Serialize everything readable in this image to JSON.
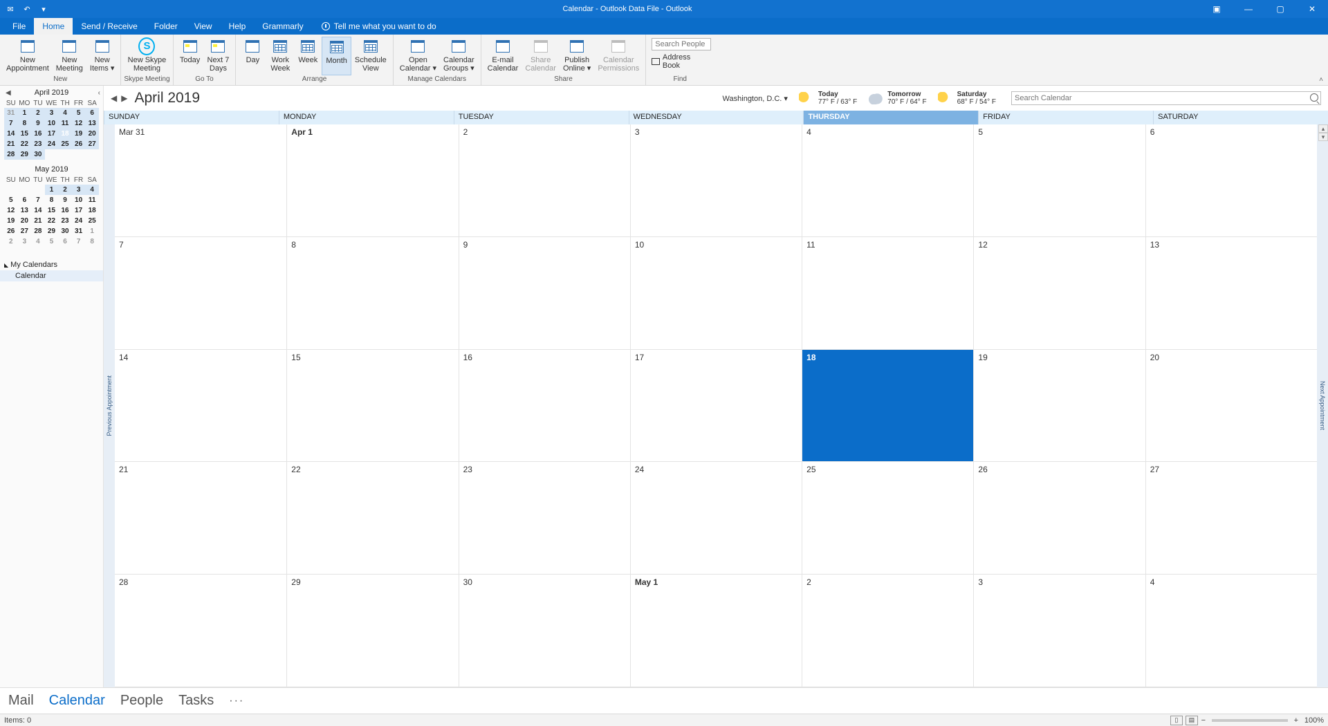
{
  "title": "Calendar - Outlook Data File  -  Outlook",
  "tabs": {
    "file": "File",
    "home": "Home",
    "sendrecv": "Send / Receive",
    "folder": "Folder",
    "view": "View",
    "help": "Help",
    "grammarly": "Grammarly",
    "tellme": "Tell me what you want to do"
  },
  "ribbon": {
    "new": {
      "label": "New",
      "appointment": "New\nAppointment",
      "meeting": "New\nMeeting",
      "items": "New\nItems ▾"
    },
    "skype": {
      "label": "Skype Meeting",
      "btn": "New Skype\nMeeting"
    },
    "goto": {
      "label": "Go To",
      "today": "Today",
      "next7": "Next 7\nDays"
    },
    "arrange": {
      "label": "Arrange",
      "day": "Day",
      "workweek": "Work\nWeek",
      "week": "Week",
      "month": "Month",
      "schedule": "Schedule\nView"
    },
    "manage": {
      "label": "Manage Calendars",
      "open": "Open\nCalendar ▾",
      "groups": "Calendar\nGroups ▾"
    },
    "share": {
      "label": "Share",
      "email": "E-mail\nCalendar",
      "sharecal": "Share\nCalendar",
      "publish": "Publish\nOnline ▾",
      "perm": "Calendar\nPermissions"
    },
    "find": {
      "label": "Find",
      "search_ph": "Search People",
      "address": "Address Book"
    }
  },
  "mini": {
    "dow": [
      "SU",
      "MO",
      "TU",
      "WE",
      "TH",
      "FR",
      "SA"
    ],
    "month1": "April 2019",
    "m1": [
      [
        "31",
        "1",
        "2",
        "3",
        "4",
        "5",
        "6"
      ],
      [
        "7",
        "8",
        "9",
        "10",
        "11",
        "12",
        "13"
      ],
      [
        "14",
        "15",
        "16",
        "17",
        "18",
        "19",
        "20"
      ],
      [
        "21",
        "22",
        "23",
        "24",
        "25",
        "26",
        "27"
      ],
      [
        "28",
        "29",
        "30",
        "",
        "",
        "",
        ""
      ]
    ],
    "month2": "May 2019",
    "m2": [
      [
        "",
        "",
        "",
        "1",
        "2",
        "3",
        "4"
      ],
      [
        "5",
        "6",
        "7",
        "8",
        "9",
        "10",
        "11"
      ],
      [
        "12",
        "13",
        "14",
        "15",
        "16",
        "17",
        "18"
      ],
      [
        "19",
        "20",
        "21",
        "22",
        "23",
        "24",
        "25"
      ],
      [
        "26",
        "27",
        "28",
        "29",
        "30",
        "31",
        "1"
      ],
      [
        "2",
        "3",
        "4",
        "5",
        "6",
        "7",
        "8"
      ]
    ],
    "mycal": "My Calendars",
    "calitem": "Calendar"
  },
  "calheader": {
    "title": "April 2019",
    "location": "Washington,  D.C.  ▾",
    "w1": {
      "lbl": "Today",
      "t": "77° F / 63° F"
    },
    "w2": {
      "lbl": "Tomorrow",
      "t": "70° F / 64° F"
    },
    "w3": {
      "lbl": "Saturday",
      "t": "68° F / 54° F"
    },
    "search_ph": "Search Calendar"
  },
  "dow": [
    "SUNDAY",
    "MONDAY",
    "TUESDAY",
    "WEDNESDAY",
    "THURSDAY",
    "FRIDAY",
    "SATURDAY"
  ],
  "cells": [
    "Mar 31",
    "Apr 1",
    "2",
    "3",
    "4",
    "5",
    "6",
    "7",
    "8",
    "9",
    "10",
    "11",
    "12",
    "13",
    "14",
    "15",
    "16",
    "17",
    "18",
    "19",
    "20",
    "21",
    "22",
    "23",
    "24",
    "25",
    "26",
    "27",
    "28",
    "29",
    "30",
    "May 1",
    "2",
    "3",
    "4"
  ],
  "prevtab": "Previous Appointment",
  "nexttab": "Next Appointment",
  "nav": {
    "mail": "Mail",
    "cal": "Calendar",
    "people": "People",
    "tasks": "Tasks",
    "more": "···"
  },
  "status": {
    "items": "Items: 0",
    "zoom": "100%"
  }
}
